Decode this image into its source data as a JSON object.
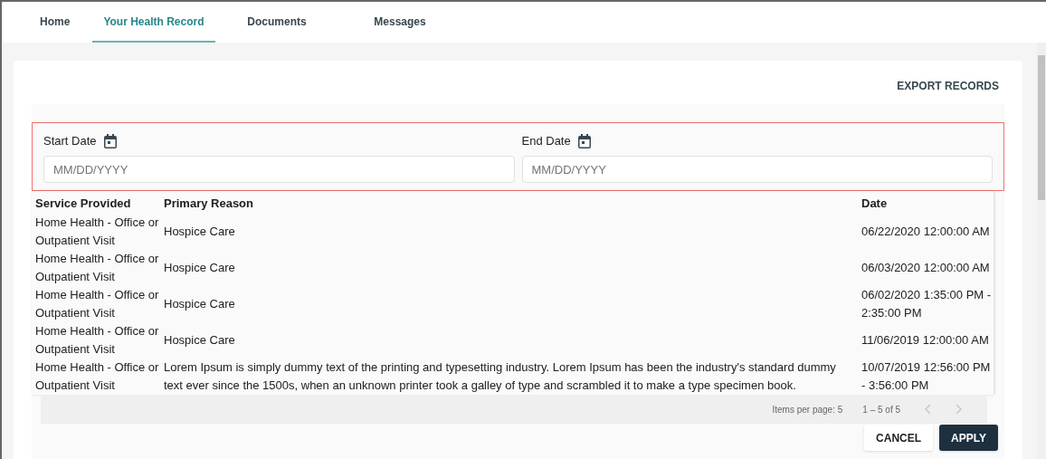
{
  "tabs": [
    {
      "label": "Home",
      "selected": false
    },
    {
      "label": "Your Health Record",
      "selected": true
    },
    {
      "label": "Documents",
      "selected": false
    },
    {
      "label": "Messages",
      "selected": false
    }
  ],
  "export_button": "EXPORT RECORDS",
  "date_filters": [
    {
      "label": "Start Date",
      "placeholder": "MM/DD/YYYY"
    },
    {
      "label": "End Date",
      "placeholder": "MM/DD/YYYY"
    }
  ],
  "table": {
    "columns": [
      "Service Provided",
      "Primary Reason",
      "Date"
    ],
    "rows": [
      [
        "Home Health - Office or Outpatient Visit",
        "Hospice Care",
        "06/22/2020 12:00:00 AM"
      ],
      [
        "Home Health - Office or Outpatient Visit",
        "Hospice Care",
        "06/03/2020 12:00:00 AM"
      ],
      [
        "Home Health - Office or Outpatient Visit",
        "Hospice Care",
        "06/02/2020 1:35:00 PM - 2:35:00 PM"
      ],
      [
        "Home Health - Office or Outpatient Visit",
        "Hospice Care",
        "11/06/2019 12:00:00 AM"
      ],
      [
        "Home Health - Office or Outpatient Visit",
        "Lorem Ipsum is simply dummy text of the printing and typesetting industry. Lorem Ipsum has been the industry's standard dummy text ever since the 1500s, when an unknown printer took a galley of type and scrambled it to make a type specimen book.",
        "10/07/2019 12:56:00 PM - 3:56:00 PM"
      ]
    ]
  },
  "paginator": {
    "items_per_page": "Items per page: 5",
    "range": "1 – 5 of 5",
    "previous_disabled": true,
    "next_disabled": true
  },
  "buttons": [
    "CANCEL",
    "APPLY"
  ]
}
